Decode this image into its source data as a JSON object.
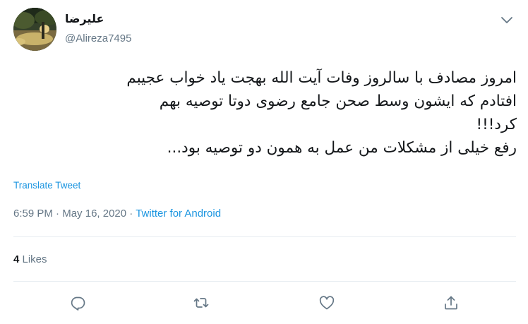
{
  "author": {
    "display_name": "علیرضا",
    "handle": "@Alireza7495"
  },
  "tweet": {
    "lines": [
      "امروز مصادف با سالروز وفات آیت الله بهجت یاد خواب عجیبم",
      "افتادم که ایشون وسط صحن جامع رضوی دوتا توصیه بهم",
      "کرد!!!",
      "رفع خیلی از مشکلات من عمل به همون دو توصیه بود..."
    ],
    "translate_label": "Translate Tweet"
  },
  "meta": {
    "time": "6:59 PM",
    "separator": " · ",
    "date": "May 16, 2020",
    "source": "Twitter for Android"
  },
  "stats": {
    "likes_count": "4",
    "likes_label": " Likes"
  },
  "icons": {
    "caret": "chevron-down-icon",
    "reply": "reply-icon",
    "retweet": "retweet-icon",
    "like": "heart-icon",
    "share": "share-icon"
  },
  "colors": {
    "link": "#1b95e0",
    "secondary_text": "#657786",
    "primary_text": "#14171a",
    "divider": "#e6ecf0"
  }
}
